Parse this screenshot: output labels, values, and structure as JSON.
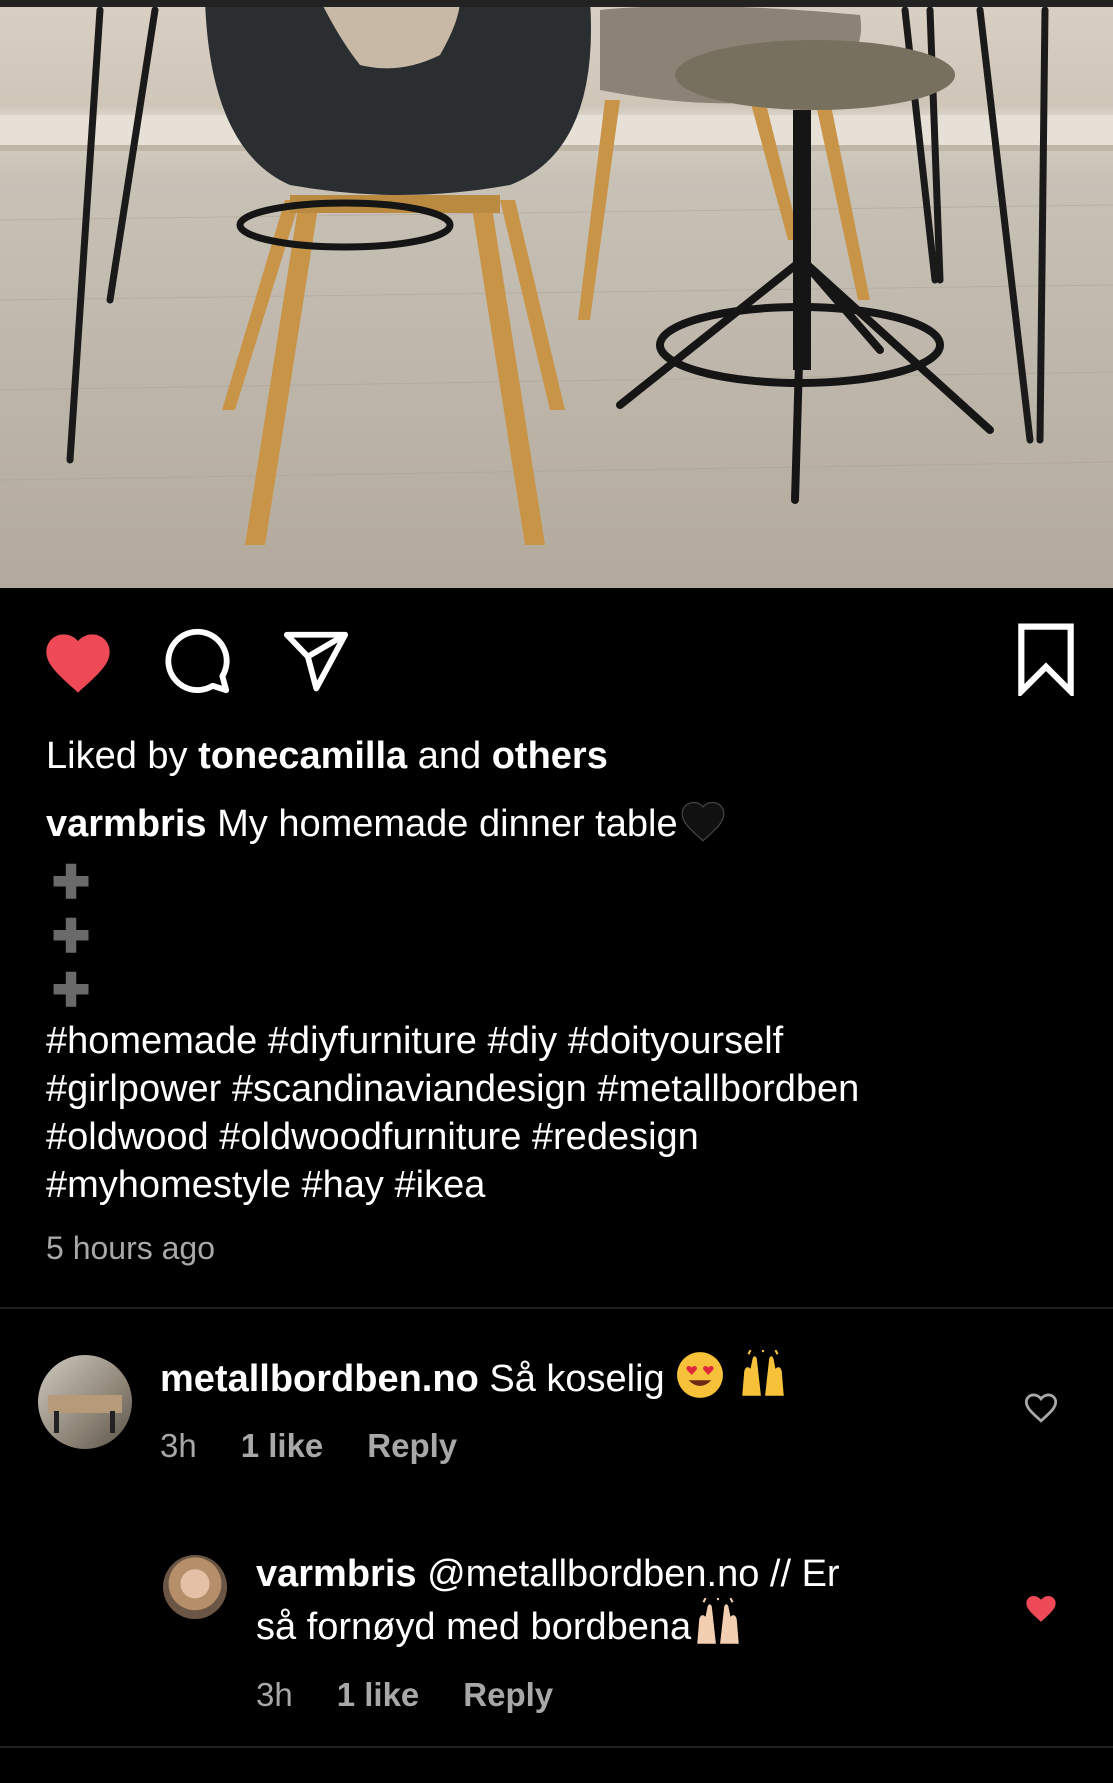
{
  "post": {
    "liked_by_prefix": "Liked by ",
    "liked_by_user": "tonecamilla",
    "liked_by_middle": " and ",
    "liked_by_others": "others",
    "author": "varmbris",
    "caption_text": "My homemade dinner table",
    "hashtags_line1": "#homemade #diyfurniture #diy #doityourself",
    "hashtags_line2": "#girlpower #scandinaviandesign #metallbordben",
    "hashtags_line3": "#oldwood #oldwoodfurniture #redesign",
    "hashtags_line4": "#myhomestyle #hay #ikea",
    "time_ago": "5 hours ago",
    "liked": true
  },
  "comments": [
    {
      "user": "metallbordben.no",
      "text": "Så koselig",
      "time": "3h",
      "likes": "1 like",
      "reply": "Reply",
      "liked": false
    },
    {
      "user": "varmbris",
      "mention": "@metallbordben.no",
      "text_line1": " // Er",
      "text_line2": "så fornøyd med bordbena",
      "time": "3h",
      "likes": "1 like",
      "reply": "Reply",
      "liked": true
    }
  ],
  "icons": {
    "like": "heart-icon",
    "comment": "comment-icon",
    "share": "paper-plane-icon",
    "save": "bookmark-icon"
  },
  "colors": {
    "heart_red": "#ed4956",
    "background": "#000000",
    "meta_gray": "#a8a8a8"
  }
}
